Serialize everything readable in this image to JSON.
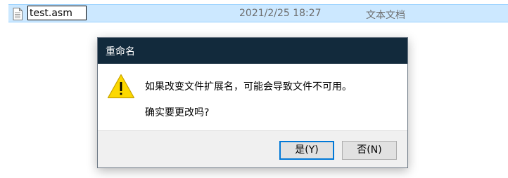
{
  "file_row": {
    "icon": "document-icon",
    "name_value": "test.asm",
    "date_modified": "2021/2/25 18:27",
    "type": "文本文档"
  },
  "dialog": {
    "title": "重命名",
    "icon": "warning-icon",
    "message": "如果改变文件扩展名，可能会导致文件不可用。",
    "question": "确实要更改吗?",
    "yes_label": "是(Y)",
    "no_label": "否(N)"
  },
  "colors": {
    "selection_bg": "#cce8ff",
    "titlebar_bg": "#122a3c",
    "default_button_border": "#0078d7",
    "warning_yellow": "#fcd800"
  }
}
